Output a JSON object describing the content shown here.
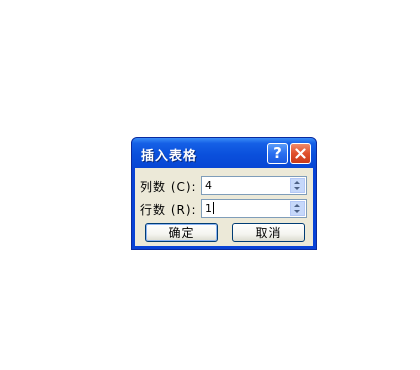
{
  "dialog": {
    "title": "插入表格",
    "help_glyph": "?",
    "help_icon": "question-mark-icon",
    "close_icon": "close-x-icon",
    "columns": {
      "label": "列数 (C):",
      "value": "4"
    },
    "rows": {
      "label": "行数 (R):",
      "value": "1"
    },
    "ok_label": "确定",
    "cancel_label": "取消"
  },
  "colors": {
    "titlebar": "#0a50dc",
    "close_button": "#e0502c",
    "dialog_face": "#ece9d8",
    "input_border": "#7f9db9"
  }
}
